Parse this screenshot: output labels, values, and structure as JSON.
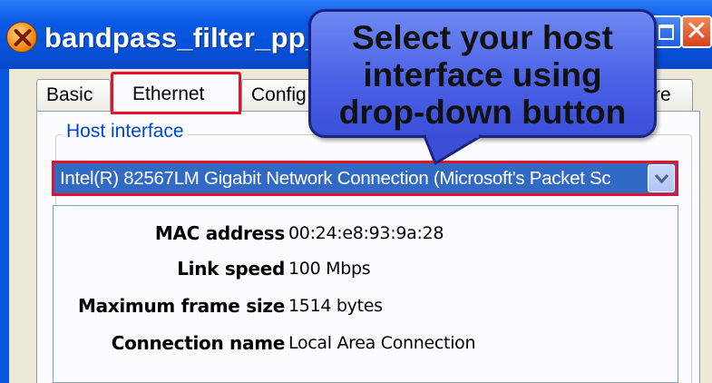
{
  "window": {
    "title": "bandpass_filter_pp_hv",
    "close_glyph": "✕"
  },
  "tabs": [
    {
      "label": "Basic",
      "active": false
    },
    {
      "label": "Ethernet",
      "active": true
    },
    {
      "label": "Config",
      "active": false
    },
    {
      "label": "re",
      "active": false
    }
  ],
  "host_interface": {
    "group_label": "Host interface",
    "selected": "Intel(R) 82567LM Gigabit Network Connection (Microsoft's Packet Sc"
  },
  "details": [
    {
      "label": "MAC address",
      "value": "00:24:e8:93:9a:28"
    },
    {
      "label": "Link speed",
      "value": "100 Mbps"
    },
    {
      "label": "Maximum frame size",
      "value": "1514 bytes"
    },
    {
      "label": "Connection name",
      "value": "Local Area Connection"
    }
  ],
  "callout": {
    "lines": [
      "Select your host",
      "interface using",
      "drop-down button"
    ]
  },
  "colors": {
    "highlight_red": "#e8102a",
    "selection_blue": "#316ac5",
    "group_label_blue": "#0046d5",
    "callout_fill": "#4c62e6"
  },
  "icons": [
    "app-icon",
    "maximize-icon",
    "close-icon",
    "chevron-down-icon"
  ]
}
